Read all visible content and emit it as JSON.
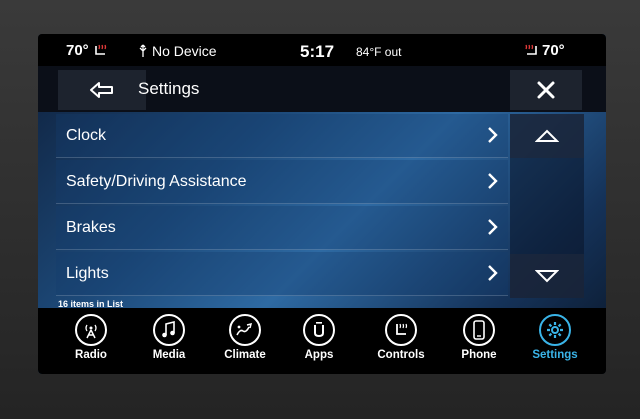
{
  "status": {
    "driver_temp": "70°",
    "device": "No Device",
    "time": "5:17",
    "outside_temp": "84°F out",
    "passenger_temp": "70°"
  },
  "header": {
    "title": "Settings"
  },
  "list": {
    "items": [
      {
        "label": "Clock"
      },
      {
        "label": "Safety/Driving Assistance"
      },
      {
        "label": "Brakes"
      },
      {
        "label": "Lights"
      }
    ],
    "count_label": "16 items in List"
  },
  "dock": {
    "items": [
      {
        "label": "Radio",
        "icon": "radio-icon"
      },
      {
        "label": "Media",
        "icon": "music-note-icon"
      },
      {
        "label": "Climate",
        "icon": "climate-icon"
      },
      {
        "label": "Apps",
        "icon": "apps-icon"
      },
      {
        "label": "Controls",
        "icon": "seat-controls-icon"
      },
      {
        "label": "Phone",
        "icon": "phone-icon"
      },
      {
        "label": "Settings",
        "icon": "gear-icon"
      }
    ],
    "active": "Settings"
  },
  "colors": {
    "accent": "#3ab4e8",
    "seat_heat": "#e23a3a"
  }
}
